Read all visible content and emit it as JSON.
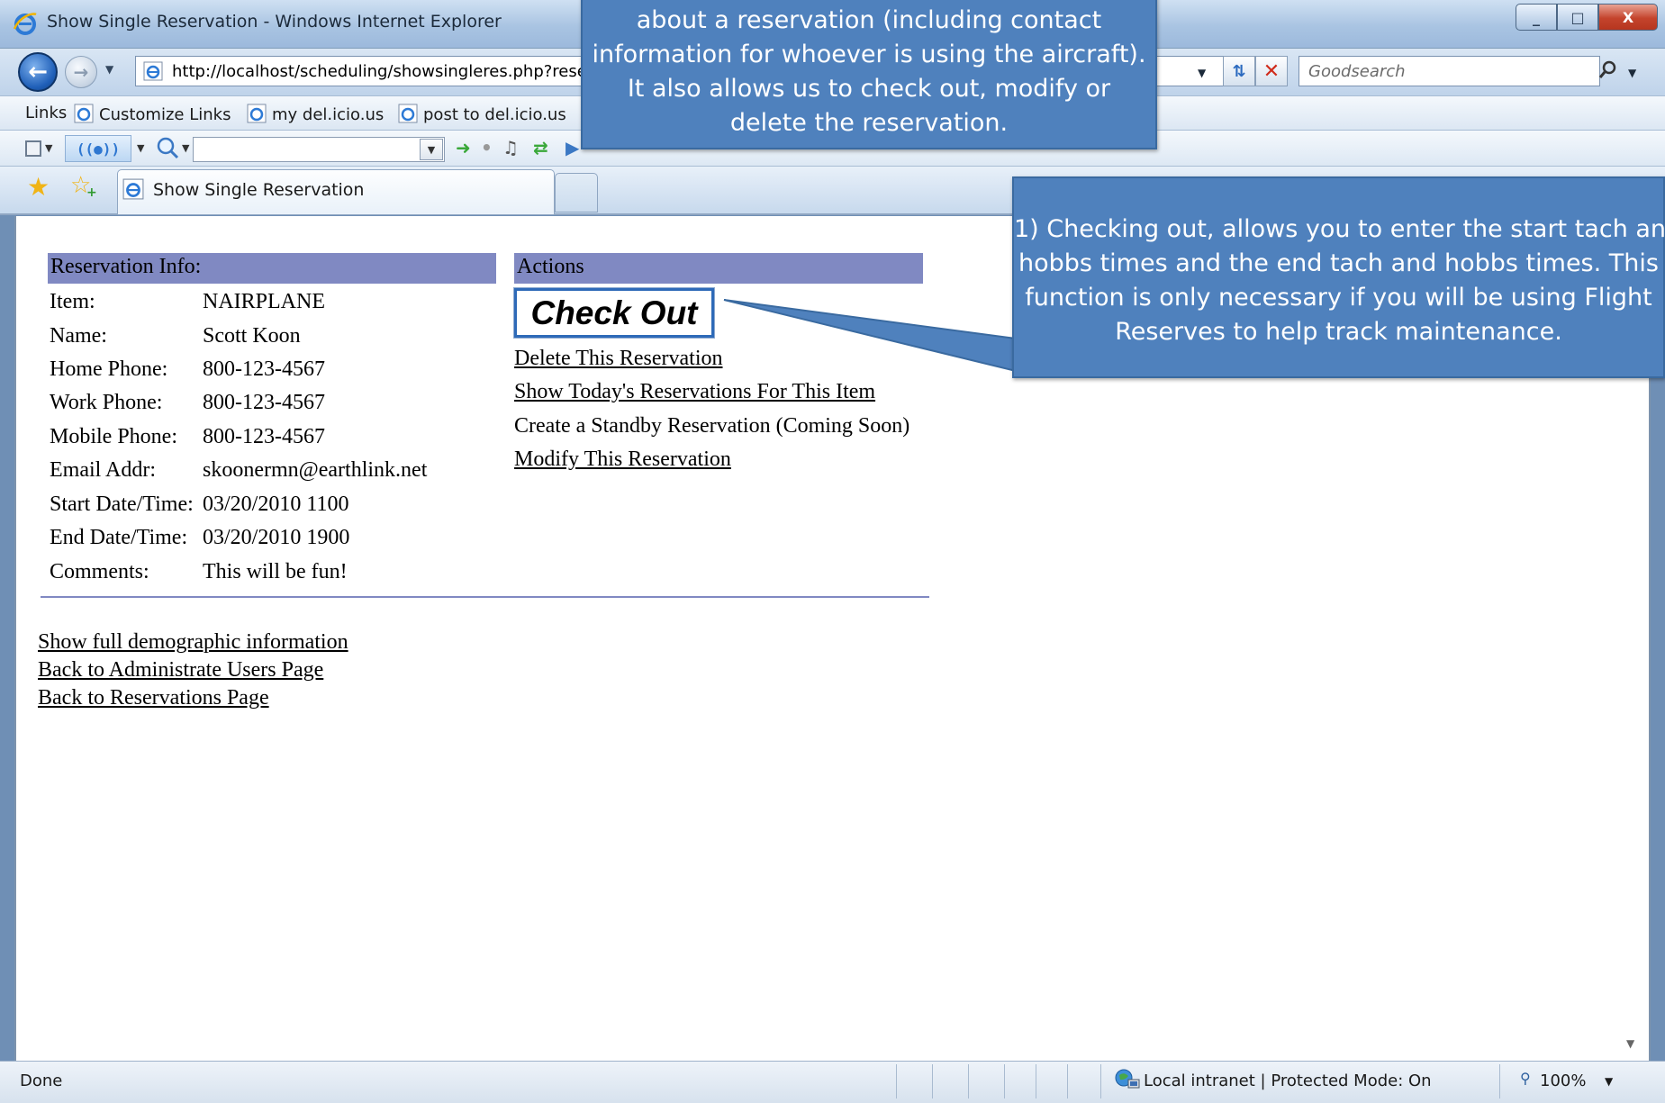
{
  "window": {
    "title": "Show Single Reservation - Windows Internet Explorer",
    "controls": [
      "_",
      "□",
      "X"
    ]
  },
  "nav": {
    "address": "http://localhost/scheduling/showsingleres.php?reser",
    "search_placeholder": "Goodsearch"
  },
  "links_bar": {
    "label": "Links",
    "items": [
      "Customize Links",
      "my del.icio.us",
      "post to del.icio.us"
    ]
  },
  "tab": {
    "title": "Show Single Reservation"
  },
  "page": {
    "reservation_header": "Reservation Info:",
    "actions_header": "Actions",
    "fields": [
      {
        "label": "Item:",
        "value": "NAIRPLANE"
      },
      {
        "label": "Name:",
        "value": "Scott Koon"
      },
      {
        "label": "Home Phone:",
        "value": "800-123-4567"
      },
      {
        "label": "Work Phone:",
        "value": "800-123-4567"
      },
      {
        "label": "Mobile Phone:",
        "value": "800-123-4567"
      },
      {
        "label": "Email Addr:",
        "value": "skoonermn@earthlink.net"
      },
      {
        "label": "Start Date/Time:",
        "value": "03/20/2010 1100"
      },
      {
        "label": "End Date/Time:",
        "value": "03/20/2010 1900"
      },
      {
        "label": "Comments:",
        "value": "This will be fun!"
      }
    ],
    "check_out_label": "Check Out",
    "actions": {
      "delete": "Delete This Reservation",
      "show_today": "Show Today's Reservations For This Item",
      "standby": "Create a Standby Reservation (Coming Soon)",
      "modify": "Modify This Reservation"
    },
    "bottom_links": [
      "Show full demographic information",
      "Back to Administrate Users Page",
      "Back to Reservations Page"
    ]
  },
  "status": {
    "text": "Done",
    "zone": "Local intranet | Protected Mode: On",
    "zoom": "100%"
  },
  "callouts": {
    "top": [
      "about a reservation (including contact",
      "information for whoever is using the aircraft).",
      "It also allows us to check out, modify or",
      "delete the reservation."
    ],
    "right": [
      "1) Checking out, allows you to enter the start tach and",
      "hobbs times and the end tach and hobbs times.  This",
      "function is only necessary if you will be using Flight",
      "Reserves to help track maintenance."
    ]
  },
  "colors": {
    "header_bg": "#8089c2",
    "callout_bg": "#4f81bd",
    "checkout_border": "#2e6ab8"
  }
}
